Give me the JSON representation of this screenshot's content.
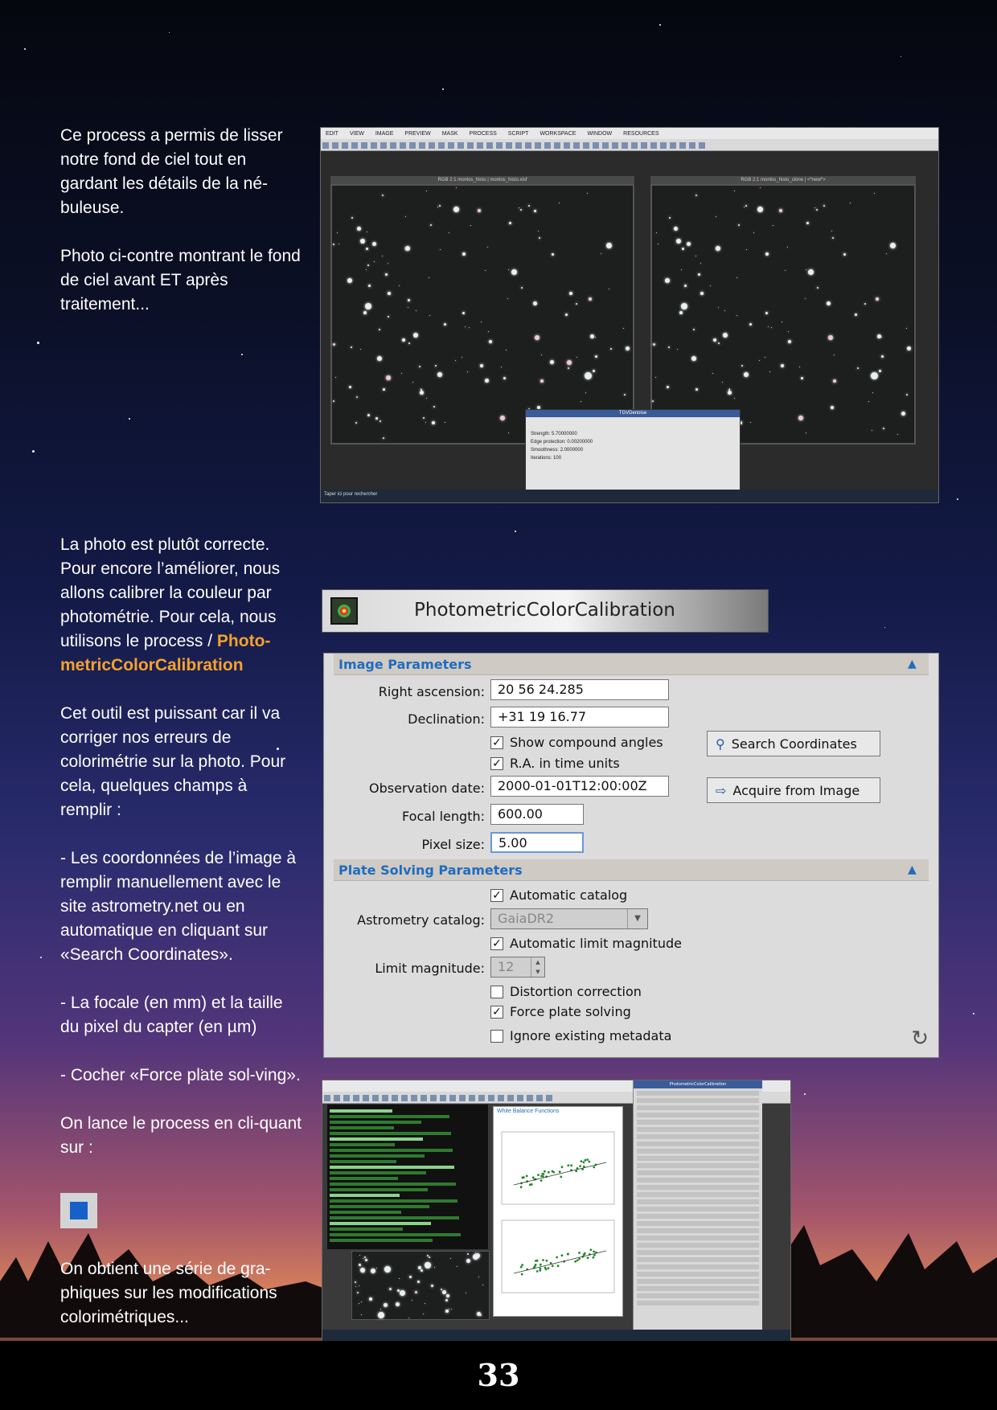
{
  "paragraphs_top": [
    "Ce process a permis de lisser notre fond de ciel tout en gardant les détails de la né-buleuse.",
    "Photo ci-contre montrant le fond de ciel avant ET après traitement..."
  ],
  "para_intro": "La photo est plutôt correcte. Pour encore l’améliorer, nous allons calibrer la couleur par photométrie. Pour cela, nous utilisons le process / ",
  "para_intro_highlight": "Photo-metricColorCalibration",
  "paragraphs_bottom": [
    "Cet outil est puissant car il va corriger nos erreurs de colorimétrie sur la photo. Pour cela, quelques champs à remplir :",
    "- Les coordonnées de l’image à remplir manuellement avec le site astrometry.net ou en automatique en cliquant sur «Search Coordinates».",
    "- La focale (en mm) et la taille du pixel du capter (en µm)",
    "- Cocher «Force plate sol-ving».",
    "On lance le process en cli-quant sur :"
  ],
  "para_final": "On obtient une série de gra-phiques sur les modifications colorimétriques...",
  "page_number": "33",
  "screenshot1": {
    "menu": [
      "EDIT",
      "VIEW",
      "IMAGE",
      "PREVIEW",
      "MASK",
      "PROCESS",
      "SCRIPT",
      "WORKSPACE",
      "WINDOW",
      "RESOURCES"
    ],
    "win_left_title": "RGB 2:1 monlos_histo | monlos_histo.xisf",
    "win_right_title": "RGB 2:1 monlos_histo_clone | <*new*>",
    "dialog_title": "TGVDenoise",
    "dialog_rows": [
      "Strength:",
      "Edge protection:",
      "Smoothness:",
      "Iterations:"
    ],
    "dialog_values": [
      "5.70000000",
      "0.00200000",
      "2.0000000",
      "100"
    ],
    "taskbar_search": "Taper ici pour rechercher"
  },
  "pcc": {
    "title": "PhotometricColorCalibration",
    "image_params_label": "Image Parameters",
    "ra_label": "Right ascension:",
    "ra_value": "20 56 24.285",
    "dec_label": "Declination:",
    "dec_value": "+31 19 16.77",
    "show_compound": "Show compound angles",
    "ra_time_units": "R.A. in time units",
    "obs_date_label": "Observation date:",
    "obs_date_value": "2000-01-01T12:00:00Z",
    "focal_label": "Focal length:",
    "focal_value": "600.00",
    "pixel_label": "Pixel size:",
    "pixel_value": "5.00",
    "search_btn": "Search Coordinates",
    "acquire_btn": "Acquire from Image",
    "plate_params_label": "Plate Solving Parameters",
    "auto_catalog": "Automatic catalog",
    "astrometry_label": "Astrometry catalog:",
    "astrometry_value": "GaiaDR2",
    "auto_limit_mag": "Automatic limit magnitude",
    "limit_mag_label": "Limit magnitude:",
    "limit_mag_value": "12",
    "distortion": "Distortion correction",
    "force_plate": "Force plate solving",
    "ignore_meta": "Ignore existing metadata"
  },
  "screenshot2": {
    "wbf_title": "White Balance Functions",
    "panel_title": "PhotometricColorCalibration"
  }
}
